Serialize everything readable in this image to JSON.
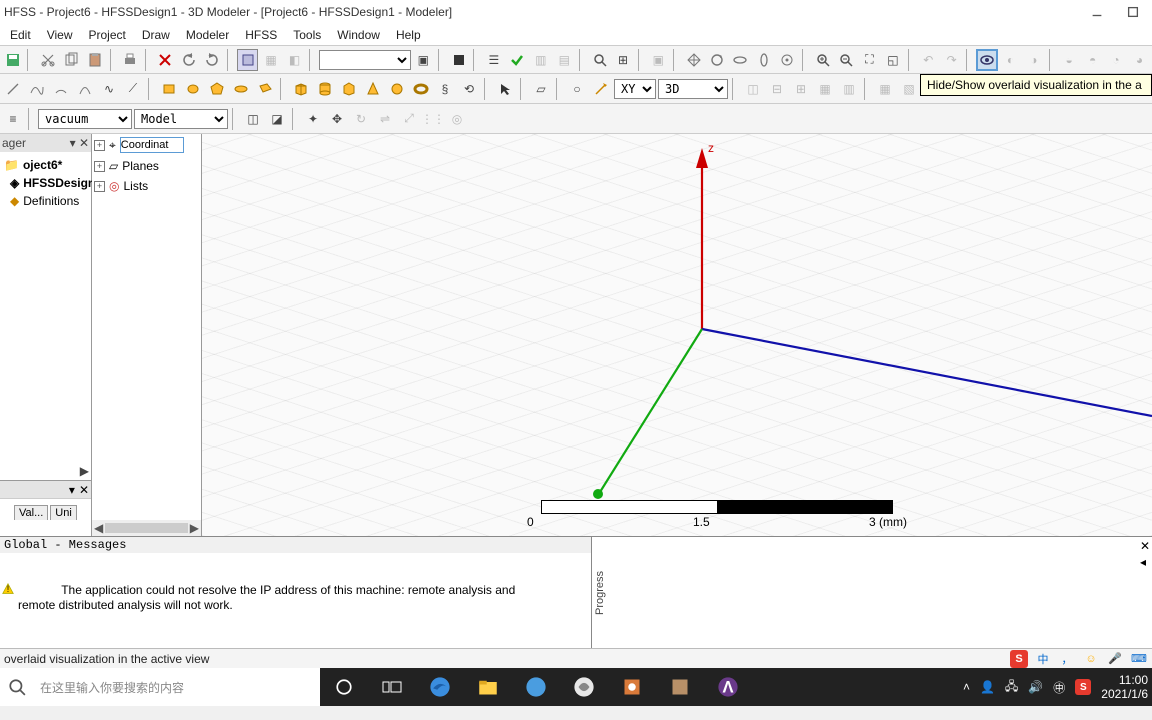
{
  "titlebar": {
    "title": "HFSS - Project6 - HFSSDesign1 - 3D Modeler - [Project6 - HFSSDesign1 - Modeler]"
  },
  "menu": {
    "edit": "Edit",
    "view": "View",
    "project": "Project",
    "draw": "Draw",
    "modeler": "Modeler",
    "hfss": "HFSS",
    "tools": "Tools",
    "window": "Window",
    "help": "Help"
  },
  "toolbars": {
    "material_combo": "vacuum",
    "model_combo": "Model",
    "plane_combo": "XY",
    "view_combo": "3D",
    "blank_combo": ""
  },
  "left_panel": {
    "header": "ager",
    "project": "oject6*",
    "design": "HFSSDesign",
    "definitions": "Definitions",
    "props_tab1": "Val...",
    "props_tab2": "Uni"
  },
  "model_tree": {
    "coord": "Coordinat",
    "planes": "Planes",
    "lists": "Lists"
  },
  "viewport": {
    "z_label": "z",
    "scale0": "0",
    "scale1": "1.5",
    "scale2": "3 (mm)"
  },
  "tooltip": "Hide/Show overlaid visualization in the a",
  "messages": {
    "title": "Global - Messages",
    "body": "The application could not resolve the IP address of this machine: remote analysis and\nremote distributed analysis will not work."
  },
  "progress": {
    "label": "Progress"
  },
  "status": {
    "text": "overlaid visualization in the active view"
  },
  "tray": {
    "sogou": "S",
    "ime": "中",
    "punct": "，",
    "face": "☺",
    "mic": "🎤"
  },
  "taskbar": {
    "search_placeholder": "在这里输入你要搜索的内容",
    "time": "11:00",
    "date": "2021/1/6"
  }
}
